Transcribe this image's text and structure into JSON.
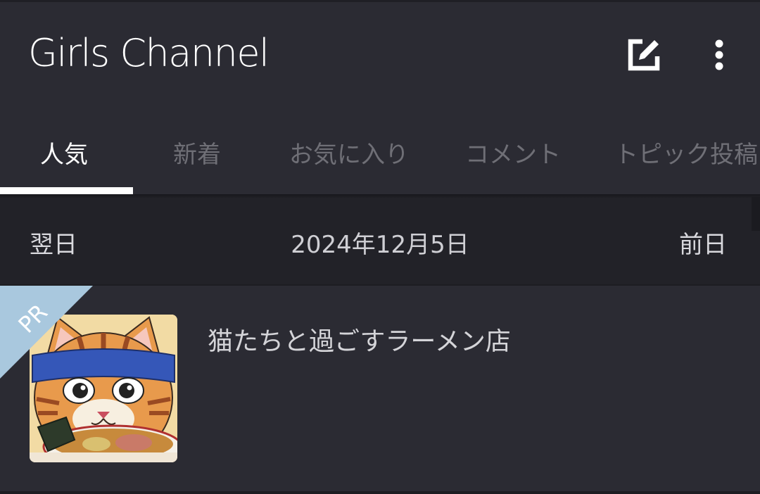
{
  "app": {
    "title": "Girls Channel",
    "edit_icon": "edit-icon",
    "more_icon": "more-vertical-icon"
  },
  "tabs": [
    {
      "label": "人気",
      "active": true
    },
    {
      "label": "新着",
      "active": false
    },
    {
      "label": "お気に入り",
      "active": false
    },
    {
      "label": "コメント",
      "active": false
    },
    {
      "label": "トピック投稿",
      "active": false
    }
  ],
  "datebar": {
    "next_label": "翌日",
    "current_date": "2024年12月5日",
    "prev_label": "前日"
  },
  "topics": [
    {
      "badge": "PR",
      "title": "猫たちと過ごすラーメン店",
      "thumbnail": "cat-ramen-illustration"
    }
  ],
  "colors": {
    "background": "#2b2b33",
    "datebar": "#222228",
    "tab_inactive": "#6f6f76",
    "pr_badge": "#a9c8de"
  }
}
